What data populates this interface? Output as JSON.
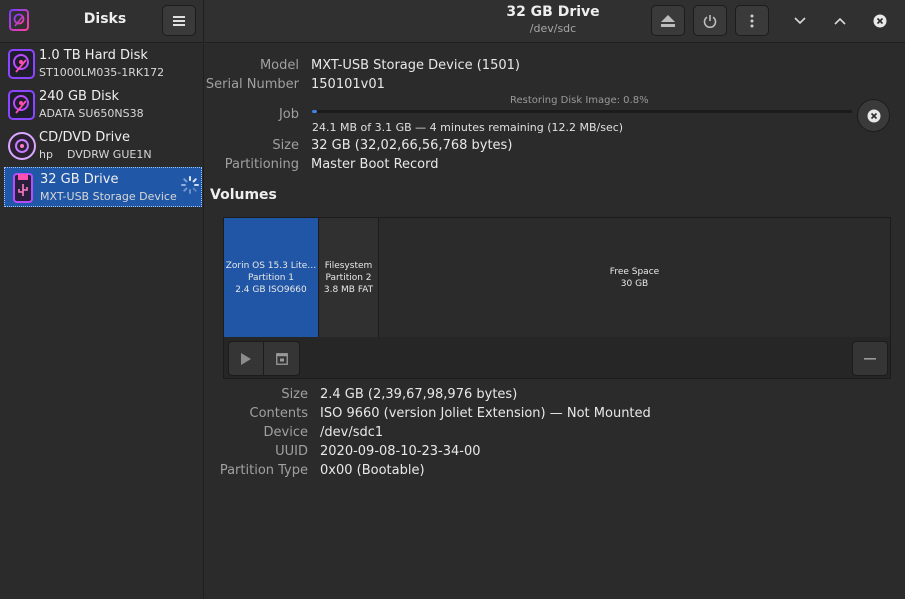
{
  "app": {
    "title": "Disks"
  },
  "header": {
    "title": "32 GB Drive",
    "subtitle": "/dev/sdc"
  },
  "sidebar": {
    "devices": [
      {
        "name": "1.0 TB Hard Disk",
        "sub": "ST1000LM035-1RK172",
        "icon": "hard-disk-icon"
      },
      {
        "name": "240 GB Disk",
        "sub": "ADATA SU650NS38",
        "icon": "hard-disk-icon"
      },
      {
        "name": "CD/DVD Drive",
        "sub_a": "hp",
        "sub_b": "DVDRW GUE1N",
        "icon": "optical-drive-icon"
      },
      {
        "name": "32 GB Drive",
        "sub": "MXT-USB Storage Device",
        "icon": "usb-drive-icon",
        "selected": true
      }
    ]
  },
  "drive": {
    "model_label": "Model",
    "model": "MXT-USB Storage Device (1501)",
    "serial_label": "Serial Number",
    "serial": "150101v01",
    "job_label": "Job",
    "job_caption": "Restoring Disk Image: 0.8%",
    "job_progress": 0.008,
    "job_detail": "24.1 MB of 3.1 GB — 4 minutes remaining (12.2 MB/sec)",
    "size_label": "Size",
    "size": "32 GB (32,02,66,56,768 bytes)",
    "partitioning_label": "Partitioning",
    "partitioning": "Master Boot Record"
  },
  "volumes": {
    "title": "Volumes",
    "partitions": [
      {
        "line1": "Zorin OS 15.3 Lite…",
        "line2": "Partition 1",
        "line3": "2.4 GB ISO9660",
        "selected": true
      },
      {
        "line1": "Filesystem",
        "line2": "Partition 2",
        "line3": "3.8 MB FAT"
      },
      {
        "line1": "Free Space",
        "line2": "30 GB"
      }
    ]
  },
  "partition": {
    "size_label": "Size",
    "size": "2.4 GB (2,39,67,98,976 bytes)",
    "contents_label": "Contents",
    "contents": "ISO 9660 (version Joliet Extension) — Not Mounted",
    "device_label": "Device",
    "device": "/dev/sdc1",
    "uuid_label": "UUID",
    "uuid": "2020-09-08-10-23-34-00",
    "type_label": "Partition Type",
    "type": "0x00 (Bootable)"
  },
  "colors": {
    "accent": "#2057a6",
    "icon_purple": "#b84bff",
    "icon_pink": "#ff4fb0"
  }
}
